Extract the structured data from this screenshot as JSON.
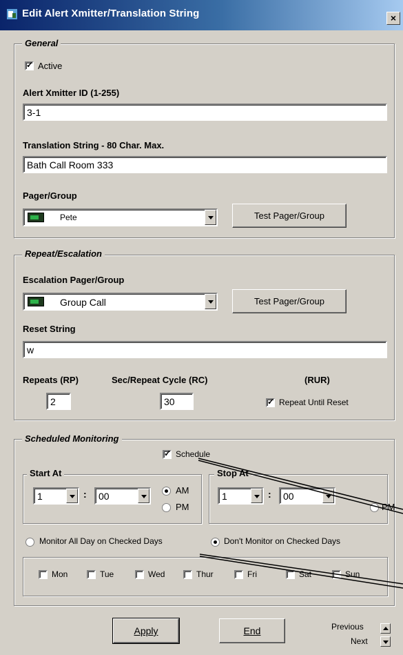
{
  "window": {
    "title": "Edit Alert Xmitter/Translation String",
    "close_label": "×"
  },
  "general": {
    "legend": "General",
    "active_label": "Active",
    "active_checked": true,
    "xmitter_id_label": "Alert Xmitter ID (1-255)",
    "xmitter_id_value": "3-1",
    "translation_label": "Translation String - 80 Char. Max.",
    "translation_value": "Bath Call Room 333",
    "pager_label": "Pager/Group",
    "pager_value": "Pete",
    "test_button": "Test Pager/Group"
  },
  "repeat": {
    "legend": "Repeat/Escalation",
    "escalation_label": "Escalation Pager/Group",
    "escalation_value": "Group Call",
    "test_button": "Test Pager/Group",
    "reset_label": "Reset String",
    "reset_value": "w",
    "repeats_label": "Repeats (RP)",
    "repeats_value": "2",
    "cycle_label": "Sec/Repeat Cycle (RC)",
    "cycle_value": "30",
    "rur_label": "(RUR)",
    "rur_checkbox_label": "Repeat Until Reset",
    "rur_checked": true
  },
  "schedule": {
    "legend": "Scheduled Monitoring",
    "schedule_label": "Schedule",
    "schedule_checked": true,
    "start": {
      "legend": "Start At",
      "hour": "1",
      "minute": "00",
      "am": "AM",
      "pm": "PM",
      "selected": "AM"
    },
    "stop": {
      "legend": "Stop At",
      "hour": "1",
      "minute": "00",
      "pm": "PM"
    },
    "colon": ":",
    "mode_all_label": "Monitor All Day on Checked Days",
    "mode_dont_label": "Don't Monitor on Checked Days",
    "mode_selected": "dont",
    "days": [
      "Mon",
      "Tue",
      "Wed",
      "Thur",
      "Fri",
      "Sat",
      "Sun"
    ]
  },
  "footer": {
    "apply_label": "Apply",
    "end_label": "End",
    "previous_label": "Previous",
    "next_label": "Next"
  }
}
